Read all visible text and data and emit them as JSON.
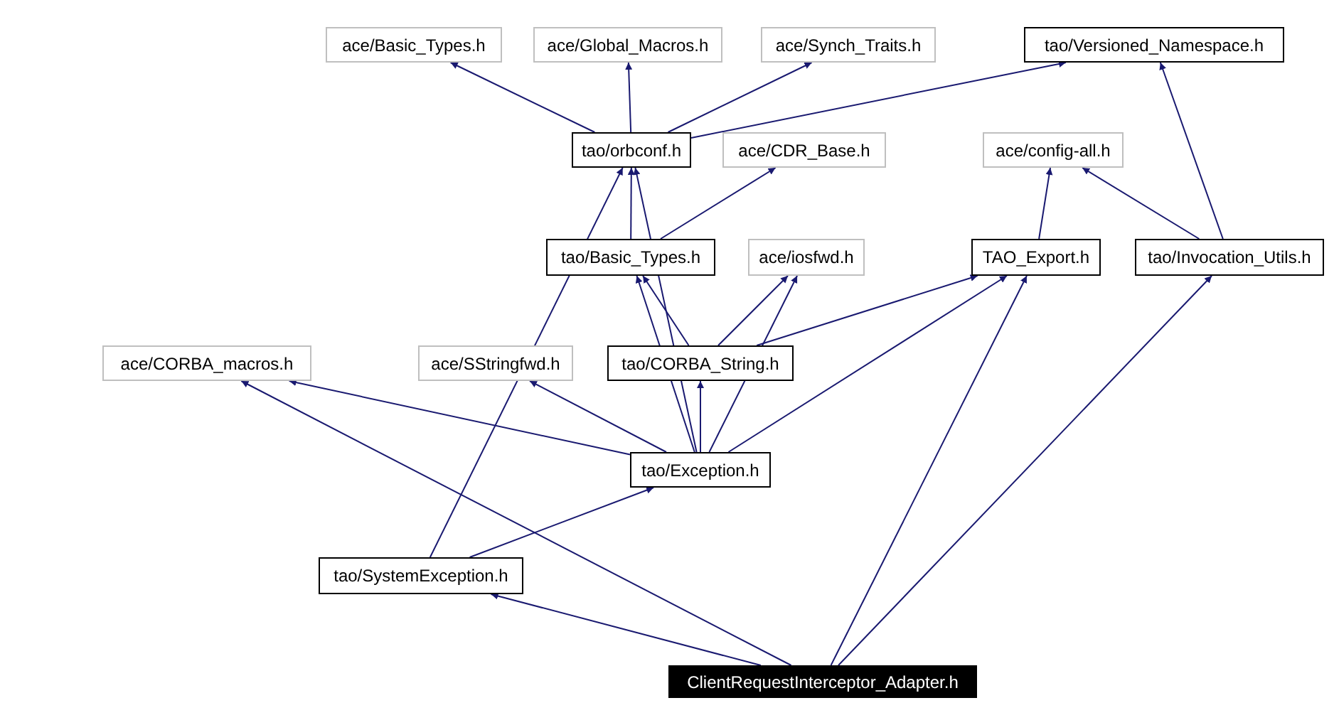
{
  "graph": {
    "nodes": [
      {
        "label": "ace/Basic_Types.h",
        "kind": "external"
      },
      {
        "label": "ace/Global_Macros.h",
        "kind": "external"
      },
      {
        "label": "ace/Synch_Traits.h",
        "kind": "external"
      },
      {
        "label": "tao/Versioned_Namespace.h",
        "kind": "internal"
      },
      {
        "label": "tao/orbconf.h",
        "kind": "internal"
      },
      {
        "label": "ace/CDR_Base.h",
        "kind": "external"
      },
      {
        "label": "ace/config-all.h",
        "kind": "external"
      },
      {
        "label": "tao/Basic_Types.h",
        "kind": "internal"
      },
      {
        "label": "ace/iosfwd.h",
        "kind": "external"
      },
      {
        "label": "TAO_Export.h",
        "kind": "internal"
      },
      {
        "label": "tao/Invocation_Utils.h",
        "kind": "internal"
      },
      {
        "label": "ace/CORBA_macros.h",
        "kind": "external"
      },
      {
        "label": "ace/SStringfwd.h",
        "kind": "external"
      },
      {
        "label": "tao/CORBA_String.h",
        "kind": "internal"
      },
      {
        "label": "tao/Exception.h",
        "kind": "internal"
      },
      {
        "label": "tao/SystemException.h",
        "kind": "internal"
      },
      {
        "label": "ClientRequestInterceptor_Adapter.h",
        "kind": "root"
      }
    ]
  }
}
